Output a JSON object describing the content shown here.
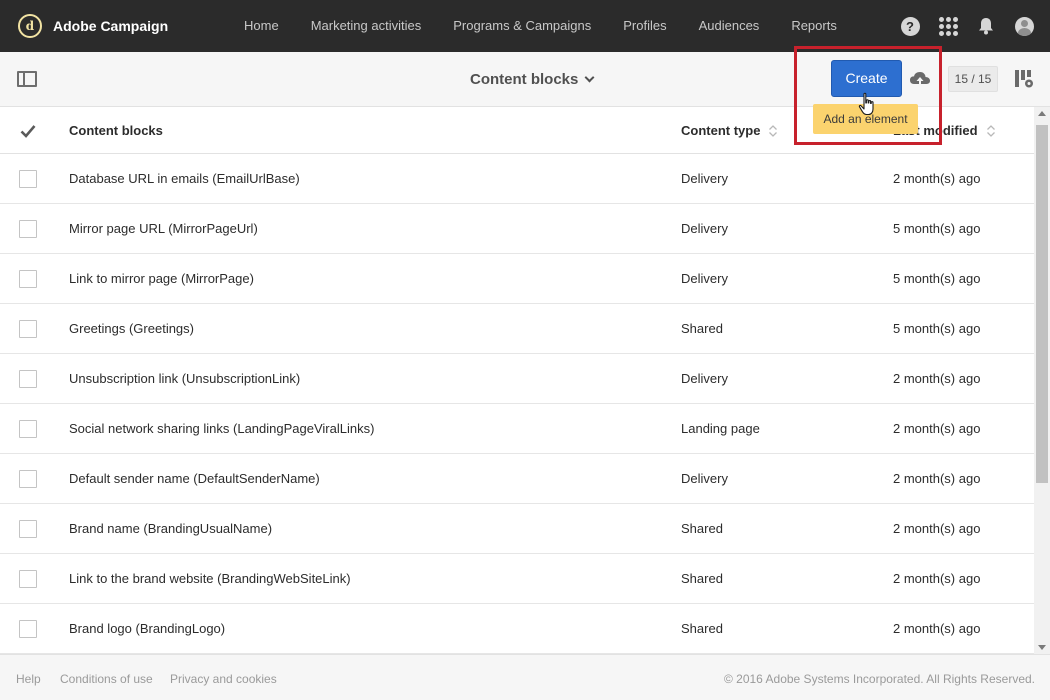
{
  "app": {
    "name": "Adobe Campaign",
    "logo_letter": "d"
  },
  "nav": {
    "links": [
      "Home",
      "Marketing activities",
      "Programs & Campaigns",
      "Profiles",
      "Audiences",
      "Reports"
    ],
    "help_symbol": "?",
    "icons": [
      "help-icon",
      "apps-grid-icon",
      "notification-bell-icon",
      "user-avatar-icon"
    ]
  },
  "toolbar": {
    "view_title": "Content blocks",
    "create_label": "Create",
    "counter": "15 / 15",
    "tooltip": "Add an element",
    "icons": [
      "panel-toggle-icon",
      "chevron-down-icon",
      "cloud-upload-icon",
      "column-config-icon",
      "hand-cursor-icon"
    ]
  },
  "table": {
    "columns": [
      "Content blocks",
      "Content type",
      "Last modified"
    ],
    "rows": [
      {
        "name": "Database URL in emails (EmailUrlBase)",
        "type": "Delivery",
        "modified": "2 month(s) ago"
      },
      {
        "name": "Mirror page URL (MirrorPageUrl)",
        "type": "Delivery",
        "modified": "5 month(s) ago"
      },
      {
        "name": "Link to mirror page (MirrorPage)",
        "type": "Delivery",
        "modified": "5 month(s) ago"
      },
      {
        "name": "Greetings (Greetings)",
        "type": "Shared",
        "modified": "5 month(s) ago"
      },
      {
        "name": "Unsubscription link (UnsubscriptionLink)",
        "type": "Delivery",
        "modified": "2 month(s) ago"
      },
      {
        "name": "Social network sharing links (LandingPageViralLinks)",
        "type": "Landing page",
        "modified": "2 month(s) ago"
      },
      {
        "name": "Default sender name (DefaultSenderName)",
        "type": "Delivery",
        "modified": "2 month(s) ago"
      },
      {
        "name": "Brand name (BrandingUsualName)",
        "type": "Shared",
        "modified": "2 month(s) ago"
      },
      {
        "name": "Link to the brand website (BrandingWebSiteLink)",
        "type": "Shared",
        "modified": "2 month(s) ago"
      },
      {
        "name": "Brand logo (BrandingLogo)",
        "type": "Shared",
        "modified": "2 month(s) ago"
      }
    ]
  },
  "footer": {
    "links": [
      "Help",
      "Conditions of use",
      "Privacy and cookies"
    ],
    "copyright": "© 2016 Adobe Systems Incorporated. All Rights Reserved."
  },
  "colors": {
    "topbar": "#2b2b2b",
    "primary_button": "#2d6fd0",
    "tooltip": "#fbd36e",
    "highlight": "#c7212c"
  }
}
